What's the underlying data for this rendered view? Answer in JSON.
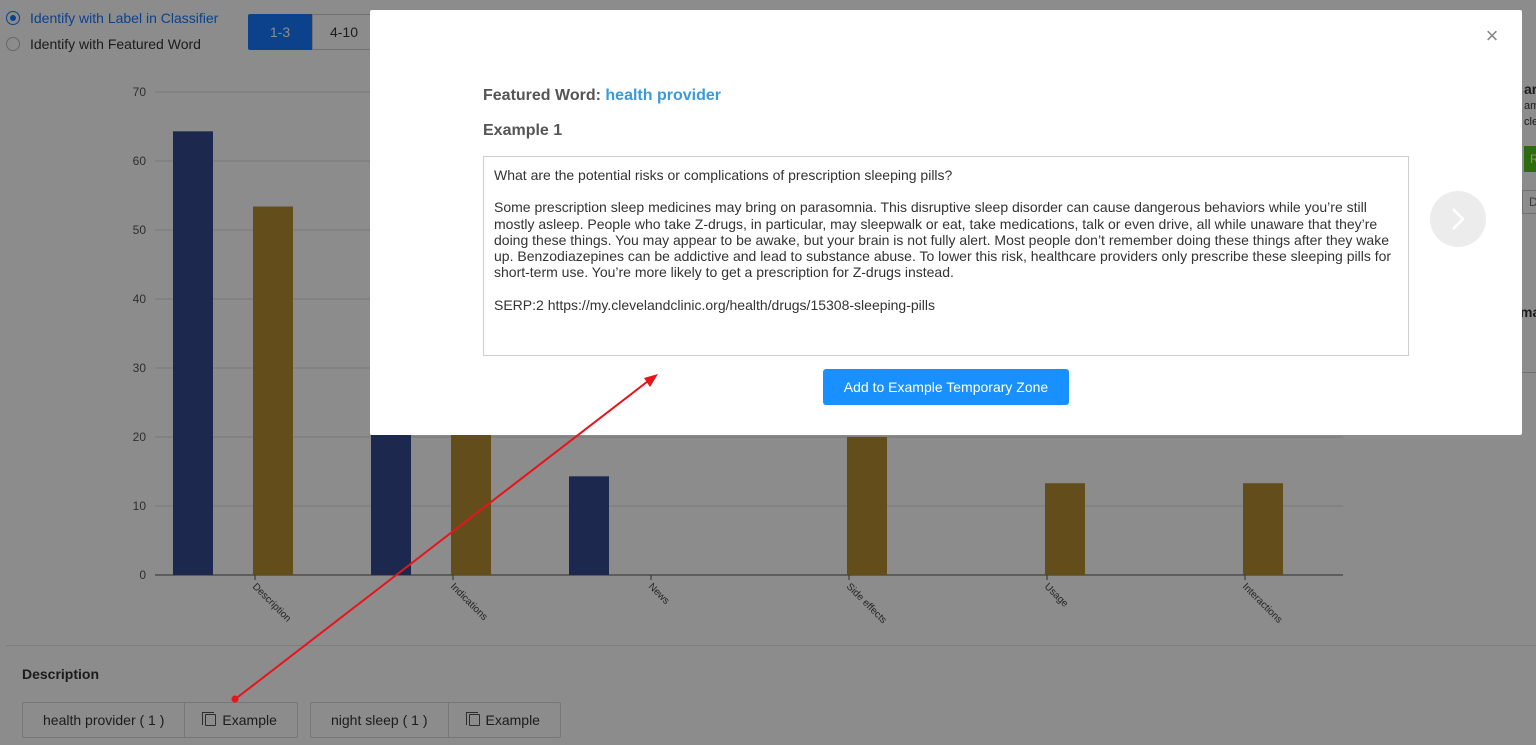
{
  "radios": [
    {
      "label": "Identify with Label in Classifier",
      "checked": true
    },
    {
      "label": "Identify with Featured Word",
      "checked": false
    }
  ],
  "range_tabs": [
    "1-3",
    "4-10"
  ],
  "chart_data": {
    "type": "bar",
    "categories": [
      "Description",
      "Indications",
      "News",
      "Side effects",
      "Usage",
      "Interactions"
    ],
    "series": [
      {
        "values": [
          64.3,
          20.5,
          14.3,
          0,
          0,
          0
        ],
        "color": "#334a8f"
      },
      {
        "values": [
          53.4,
          20.5,
          0,
          20.0,
          13.3,
          13.3
        ],
        "color": "#b48c32"
      }
    ],
    "yticks": [
      0,
      10,
      20,
      30,
      40,
      50,
      60,
      70
    ],
    "ylim": [
      0,
      70
    ],
    "grid": true
  },
  "right_panel": {
    "text1": "ar",
    "text2": "am",
    "text3": "cle",
    "green_label": "R",
    "input_text": "D",
    "text4": "ma"
  },
  "bottom": {
    "title": "Description",
    "tags": [
      {
        "word": "health provider ( 1 )",
        "action": "Example"
      },
      {
        "word": "night sleep ( 1 )",
        "action": "Example"
      }
    ]
  },
  "modal": {
    "featured_label": "Featured Word:",
    "featured_value": "health provider",
    "example_title": "Example 1",
    "question": "What are the potential risks or complications of prescription sleeping pills?",
    "body": "Some prescription sleep medicines may bring on parasomnia. This disruptive sleep disorder can cause dangerous behaviors while you’re still mostly asleep. People who take Z-drugs, in particular, may sleepwalk or eat, take medications, talk or even drive, all while unaware that they’re doing these things. You may appear to be awake, but your brain is not fully alert. Most people don’t remember doing these things after they wake up. Benzodiazepines can be addictive and lead to substance abuse. To lower this risk, healthcare providers only prescribe these sleeping pills for short-term use. You’re more likely to get a prescription for Z-drugs instead.",
    "source": "SERP:2 https://my.clevelandclinic.org/health/drugs/15308-sleeping-pills",
    "add_button": "Add to Example Temporary Zone",
    "close_icon": "close-icon",
    "next_icon": "chevron-right-icon"
  },
  "annotation_color": "#e8141c"
}
